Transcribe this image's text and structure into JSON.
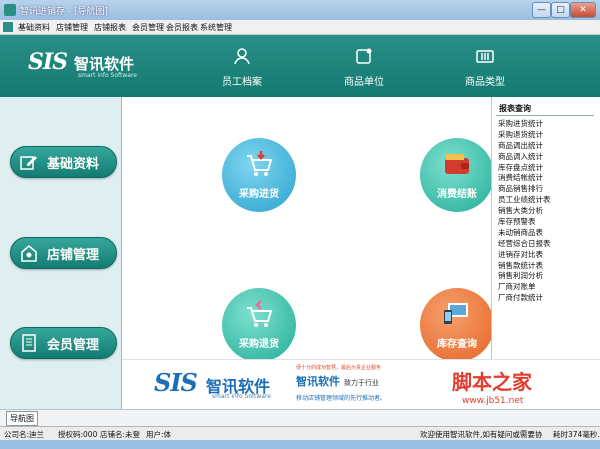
{
  "window": {
    "title": "智讯进销存 - [导航图]",
    "controls": {
      "minimize": "—",
      "maximize": "□",
      "close": "✕"
    }
  },
  "menu": {
    "items": [
      "基础资料",
      "店铺管理",
      "店铺报表",
      "会员管理",
      "会员报表",
      "系统管理"
    ]
  },
  "header": {
    "logo": {
      "sis": "SIS",
      "cn": "智讯软件",
      "en": "smart info Software"
    },
    "nav": [
      {
        "label": "员工档案",
        "icon": "user-icon"
      },
      {
        "label": "商品单位",
        "icon": "tag-icon"
      },
      {
        "label": "商品类型",
        "icon": "category-icon"
      }
    ]
  },
  "left_buttons": [
    {
      "label": "基础资料",
      "icon": "edit-icon"
    },
    {
      "label": "店铺管理",
      "icon": "store-icon"
    },
    {
      "label": "会员管理",
      "icon": "book-icon"
    }
  ],
  "tiles": [
    {
      "label": "采购进货",
      "icon": "cart-in-icon"
    },
    {
      "label": "消费结账",
      "icon": "wallet-icon"
    },
    {
      "label": "采购退货",
      "icon": "cart-return-icon"
    },
    {
      "label": "库存查询",
      "icon": "devices-icon"
    }
  ],
  "reports": {
    "title": "报表查询",
    "items": [
      "采购进货统计",
      "采购退货统计",
      "商品调出统计",
      "商品调入统计",
      "库存盘点统计",
      "消费结帐统计",
      "商品销售排行",
      "员工业绩统计表",
      "销售大类分析",
      "库存预警表",
      "未动销商品表",
      "经营综合日报表",
      "进销存对比表",
      "销售款统计表",
      "销售利润分析",
      "厂商对账单",
      "厂商付款统计"
    ]
  },
  "banner": {
    "logo": {
      "sis": "SIS",
      "cn": "智讯软件",
      "en": "smart info Software"
    },
    "ad_line1": "便十分的成功智慧，最后为贵企业服务",
    "ad_line2": "智讯软件",
    "ad_tag": "致力于行业",
    "ad_line3": "移动店铺管理领域的先行推动者。",
    "watermark": "脚本之家",
    "watermark_url": "www.jb51.net"
  },
  "tabs": [
    "导航图"
  ],
  "status": {
    "company": "公司名:迪兰",
    "auth": "授权码:000",
    "store": "店铺名:未登",
    "user": "用户:体",
    "welcome": "欢迎使用智讯软件,如有疑问或需要协",
    "timing": "耗时374毫秒."
  },
  "colors": {
    "primary": "#137a70",
    "accent_blue": "#2ba1cf",
    "accent_green": "#21ad97",
    "accent_orange": "#e56225"
  }
}
